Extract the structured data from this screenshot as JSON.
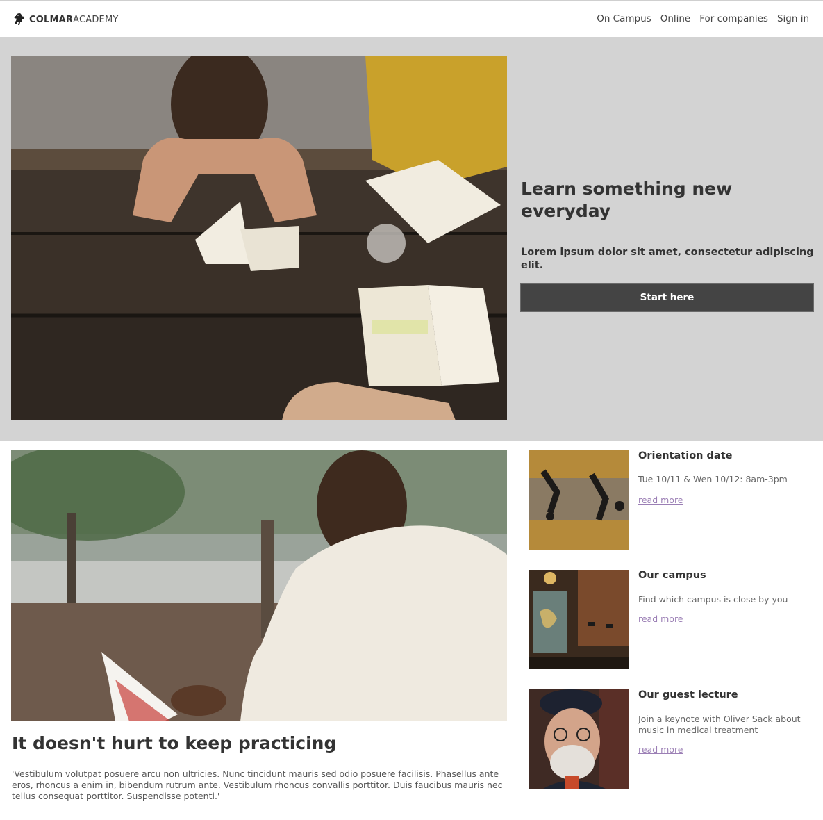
{
  "header": {
    "logo_strong": "COLMAR",
    "logo_light": "ACADEMY",
    "logo_icon": "heraldic-lion-icon",
    "nav": [
      "On Campus",
      "Online",
      "For companies",
      "Sign in"
    ]
  },
  "hero": {
    "image": "students-studying-at-picnic-table-photo",
    "title": "Learn something new everyday",
    "subtitle": "Lorem ipsum dolor sit amet, consectetur adipiscing elit.",
    "button_label": "Start here"
  },
  "feature": {
    "image": "man-reading-book-outdoors-photo",
    "title": "It doesn't hurt to keep practicing",
    "text": "'Vestibulum volutpat posuere arcu non ultricies. Nunc tincidunt mauris sed odio posuere facilisis. Phasellus ante eros, rhoncus a enim in, bibendum rutrum ante. Vestibulum rhoncus convallis porttitor. Duis faucibus mauris nec tellus consequat porttitor. Suspendisse potenti.'"
  },
  "cards": [
    {
      "image": "people-walking-shadows-photo",
      "title": "Orientation date",
      "text": "Tue 10/11 & Wen 10/12: 8am-3pm",
      "link": "read more"
    },
    {
      "image": "cafe-interior-with-map-photo",
      "title": "Our campus",
      "text": "Find which campus is close by you",
      "link": "read more"
    },
    {
      "image": "elderly-man-with-beret-portrait-photo",
      "title": "Our guest lecture",
      "text": "Join a keynote with Oliver Sack about music in medical treatment",
      "link": "read more"
    }
  ],
  "colors": {
    "hero_bg": "#d3d3d3",
    "button_bg": "#444444",
    "link": "#9b7fb5",
    "text": "#333333"
  }
}
